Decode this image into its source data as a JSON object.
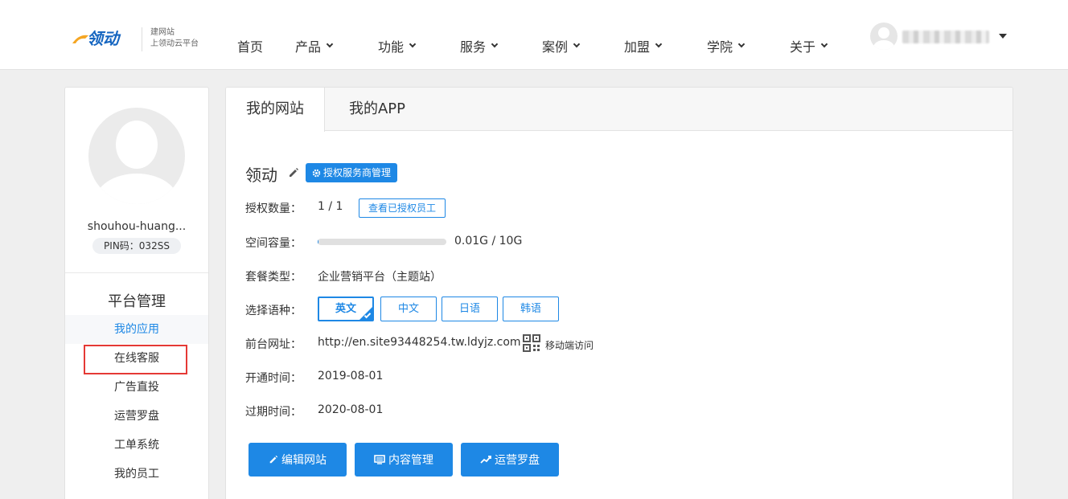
{
  "header": {
    "logo_text": "领动",
    "logo_sub1": "建网站",
    "logo_sub2": "上领动云平台",
    "nav": [
      {
        "label": "首页",
        "has_dropdown": false
      },
      {
        "label": "产品",
        "has_dropdown": true
      },
      {
        "label": "功能",
        "has_dropdown": true
      },
      {
        "label": "服务",
        "has_dropdown": true
      },
      {
        "label": "案例",
        "has_dropdown": true
      },
      {
        "label": "加盟",
        "has_dropdown": true
      },
      {
        "label": "学院",
        "has_dropdown": true
      },
      {
        "label": "关于",
        "has_dropdown": true
      }
    ]
  },
  "sidebar": {
    "username": "shouhou-huang...",
    "pin": "PIN码：032SS",
    "section_title": "平台管理",
    "items": [
      {
        "label": "我的应用",
        "active": true
      },
      {
        "label": "在线客服",
        "active": false,
        "highlighted": true
      },
      {
        "label": "广告直投",
        "active": false
      },
      {
        "label": "运营罗盘",
        "active": false
      },
      {
        "label": "工单系统",
        "active": false
      },
      {
        "label": "我的员工",
        "active": false
      }
    ]
  },
  "main": {
    "tabs": [
      {
        "label": "我的网站",
        "active": true
      },
      {
        "label": "我的APP",
        "active": false
      }
    ],
    "site_title": "领动",
    "auth_button": "授权服务商管理",
    "rows": {
      "auth_count_label": "授权数量：",
      "auth_count_value": "1 / 1",
      "view_staff_button": "查看已授权员工",
      "storage_label": "空间容量：",
      "storage_value": "0.01G / 10G",
      "storage_fraction": 0.001,
      "plan_label": "套餐类型：",
      "plan_value": "企业营销平台（主题站）",
      "lang_label": "选择语种：",
      "url_label": "前台网址：",
      "url_value": "http://en.site93448254.tw.ldyjz.com",
      "mobile_link": "移动端访问",
      "open_label": "开通时间：",
      "open_value": "2019-08-01",
      "expire_label": "过期时间：",
      "expire_value": "2020-08-01"
    },
    "languages": [
      {
        "label": "英文",
        "active": true
      },
      {
        "label": "中文",
        "active": false
      },
      {
        "label": "日语",
        "active": false
      },
      {
        "label": "韩语",
        "active": false
      }
    ],
    "actions": [
      {
        "label": "编辑网站",
        "icon": "pencil-icon"
      },
      {
        "label": "内容管理",
        "icon": "monitor-icon"
      },
      {
        "label": "运营罗盘",
        "icon": "trend-icon"
      }
    ]
  },
  "colors": {
    "accent": "#1e88e5",
    "highlight": "#e53935",
    "background": "#efefef"
  }
}
